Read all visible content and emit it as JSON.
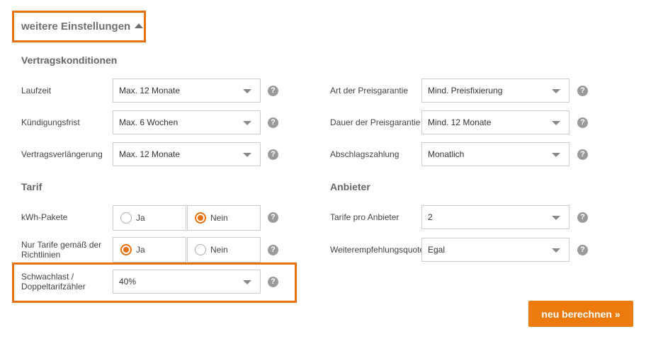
{
  "toggle": {
    "label": "weitere Einstellungen"
  },
  "sections": {
    "vertragskonditionen": "Vertragskonditionen",
    "tarif": "Tarif",
    "anbieter": "Anbieter"
  },
  "left": {
    "laufzeit": {
      "label": "Laufzeit",
      "value": "Max. 12 Monate"
    },
    "kuendigungsfrist": {
      "label": "Kündigungsfrist",
      "value": "Max. 6 Wochen"
    },
    "vertragsverlaengerung": {
      "label": "Vertragsverlängerung",
      "value": "Max. 12 Monate"
    },
    "kwh_pakete": {
      "label": "kWh-Pakete",
      "option_yes": "Ja",
      "option_no": "Nein",
      "selected": "Nein"
    },
    "richtlinien": {
      "label_line1": "Nur Tarife gemäß der",
      "label_line2": "Richtlinien",
      "option_yes": "Ja",
      "option_no": "Nein",
      "selected": "Ja"
    },
    "schwachlast": {
      "label_line1": "Schwachlast /",
      "label_line2": "Doppeltarifzähler",
      "value": "40%"
    }
  },
  "right": {
    "preisgarantie_art": {
      "label": "Art der Preisgarantie",
      "value": "Mind. Preisfixierung"
    },
    "preisgarantie_dauer": {
      "label": "Dauer der Preisgarantie",
      "value": "Mind. 12 Monate"
    },
    "abschlagszahlung": {
      "label": "Abschlagszahlung",
      "value": "Monatlich"
    },
    "tarife_pro_anbieter": {
      "label": "Tarife pro Anbieter",
      "value": "2"
    },
    "weiterempfehlungsquote": {
      "label": "Weiterempfehlungsquote",
      "value": "Egal"
    }
  },
  "help_symbol": "?",
  "button": {
    "label": "neu berechnen »"
  },
  "colors": {
    "accent": "#e8700a",
    "help_icon": "#9a9a9a",
    "border": "#cccccc"
  }
}
